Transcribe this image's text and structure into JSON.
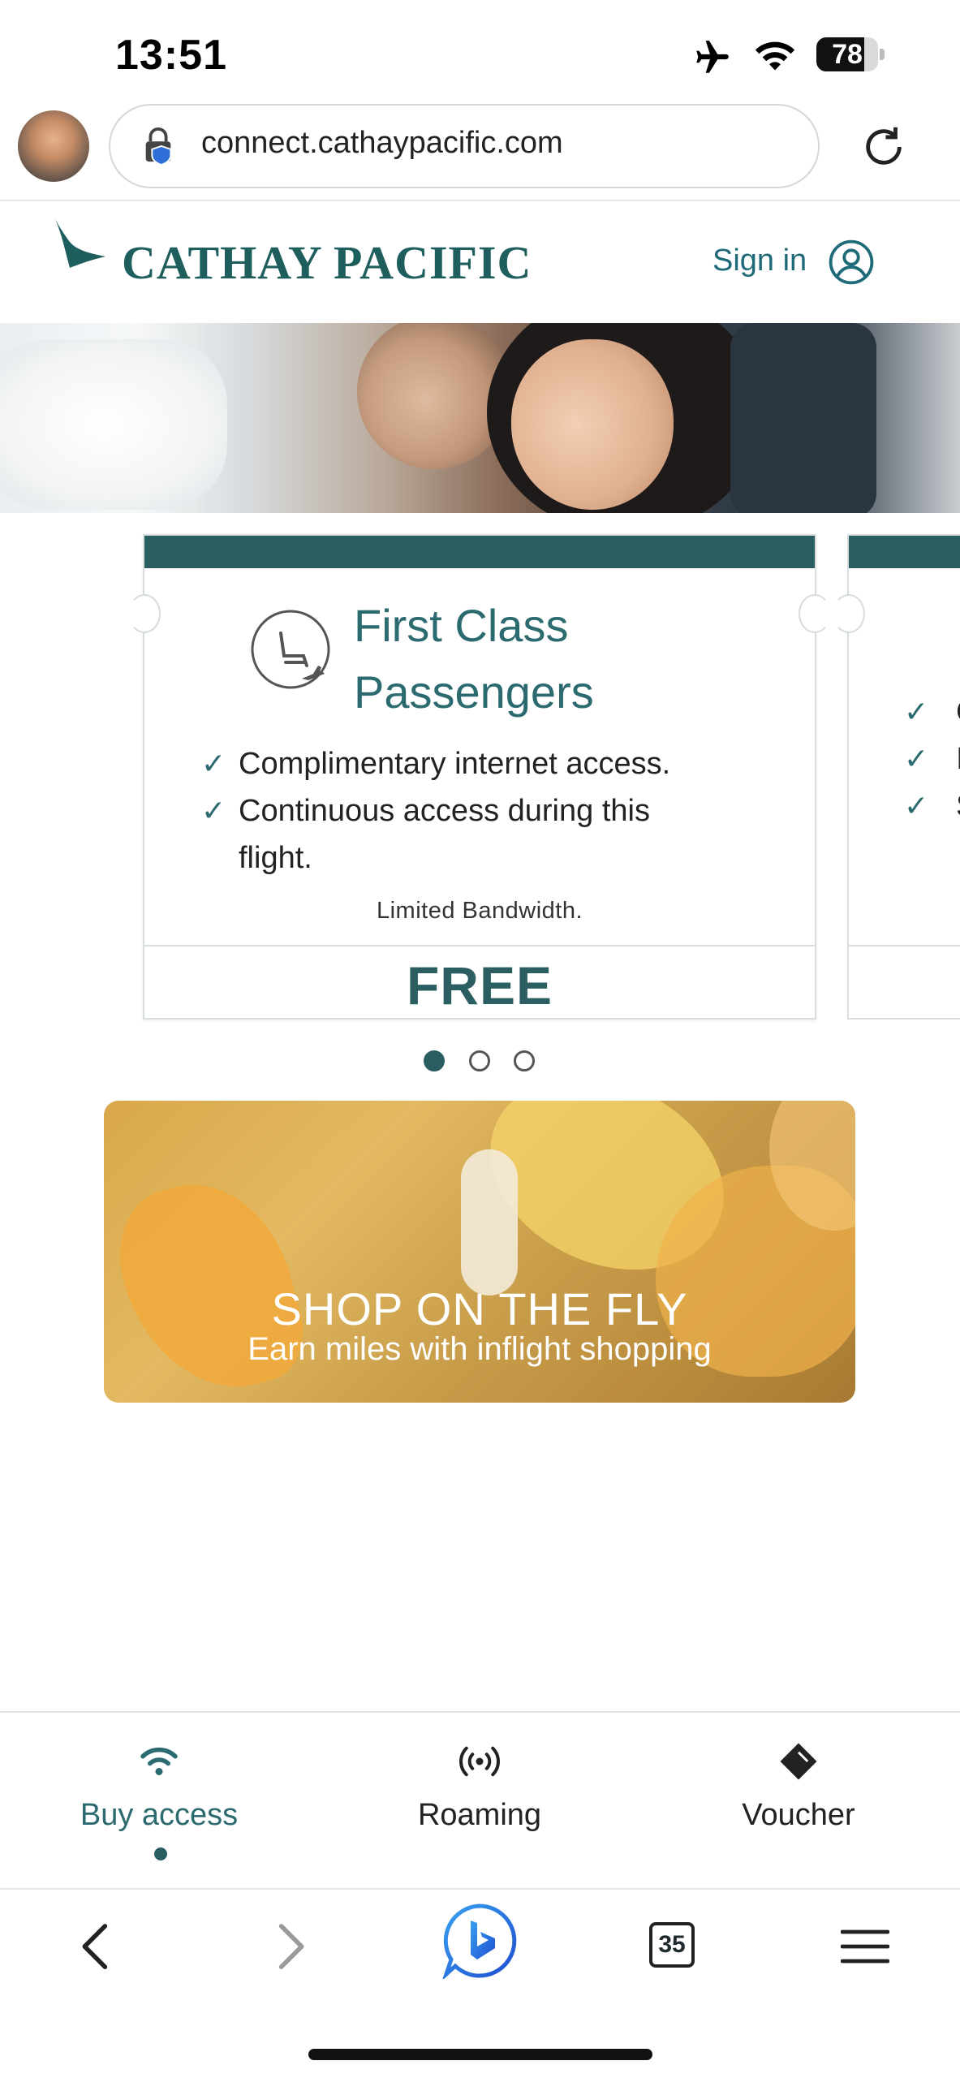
{
  "status_bar": {
    "time": "13:51",
    "battery_level": "78",
    "battery_fraction": 0.78
  },
  "browser": {
    "url": "connect.cathaypacific.com",
    "tab_count": "35"
  },
  "site_header": {
    "brand": "CATHAY PACIFIC",
    "sign_in": "Sign in"
  },
  "carousel": {
    "current_card": {
      "title": "First Class Passengers",
      "features": [
        "Complimentary internet access.",
        "Continuous access during this flight."
      ],
      "note": "Limited Bandwidth.",
      "price": "FREE"
    },
    "next_card_peek": {
      "letters": [
        "C",
        "I",
        "S"
      ]
    },
    "pages": 3,
    "active_page": 1
  },
  "promo": {
    "title": "SHOP ON THE FLY",
    "subtitle": "Earn miles with inflight shopping"
  },
  "bottom_nav": {
    "items": [
      {
        "label": "Buy access",
        "icon": "wifi-icon",
        "active": true
      },
      {
        "label": "Roaming",
        "icon": "roaming-icon",
        "active": false
      },
      {
        "label": "Voucher",
        "icon": "voucher-icon",
        "active": false
      }
    ]
  },
  "colors": {
    "brand_teal": "#2b5e60",
    "link_teal": "#1e6a78"
  }
}
